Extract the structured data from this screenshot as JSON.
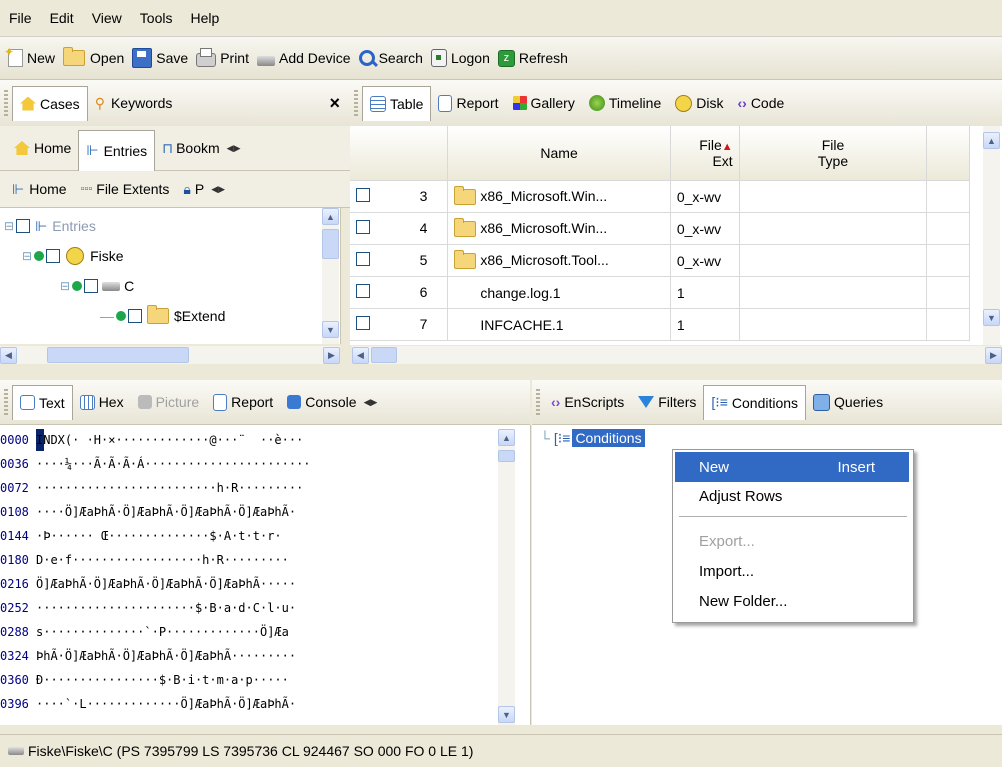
{
  "menu": [
    "File",
    "Edit",
    "View",
    "Tools",
    "Help"
  ],
  "toolbar": [
    {
      "label": "New",
      "icon": "new-icon"
    },
    {
      "label": "Open",
      "icon": "open-folder-icon"
    },
    {
      "label": "Save",
      "icon": "save-icon"
    },
    {
      "label": "Print",
      "icon": "print-icon"
    },
    {
      "label": "Add Device",
      "icon": "add-device-icon"
    },
    {
      "label": "Search",
      "icon": "search-icon"
    },
    {
      "label": "Logon",
      "icon": "logon-icon"
    },
    {
      "label": "Refresh",
      "icon": "refresh-icon"
    }
  ],
  "left_tabs": {
    "cases": "Cases",
    "keywords": "Keywords",
    "close": "×"
  },
  "left_subtabs": {
    "home": "Home",
    "entries": "Entries",
    "bookmarks": "Bookm"
  },
  "left_subtabs2": {
    "home": "Home",
    "file_extents": "File Extents",
    "p": "P"
  },
  "tree": {
    "entries": "Entries",
    "fiske": "Fiske",
    "c": "C",
    "extend": "$Extend"
  },
  "view_tabs": [
    "Table",
    "Report",
    "Gallery",
    "Timeline",
    "Disk",
    "Code"
  ],
  "table": {
    "columns": {
      "name": "Name",
      "ext_line1": "File",
      "ext_line2": "Ext",
      "type_line1": "File",
      "type_line2": "Type"
    },
    "rows": [
      {
        "num": "3",
        "name": "x86_Microsoft.Win...",
        "ext": "0_x-wv",
        "folder": true
      },
      {
        "num": "4",
        "name": "x86_Microsoft.Win...",
        "ext": "0_x-wv",
        "folder": true
      },
      {
        "num": "5",
        "name": "x86_Microsoft.Tool...",
        "ext": "0_x-wv",
        "folder": true
      },
      {
        "num": "6",
        "name": "change.log.1",
        "ext": "1",
        "folder": false
      },
      {
        "num": "7",
        "name": "INFCACHE.1",
        "ext": "1",
        "folder": false
      }
    ]
  },
  "bottom_left_tabs": [
    "Text",
    "Hex",
    "Picture",
    "Report",
    "Console"
  ],
  "bottom_right_tabs": [
    "EnScripts",
    "Filters",
    "Conditions",
    "Queries"
  ],
  "hex": {
    "rows": [
      {
        "off": "0000",
        "text": "INDX(· ·H·×·············@···¨  ··è···"
      },
      {
        "off": "0036",
        "text": "····¼···Ã·Ã·Ã·Á·······················"
      },
      {
        "off": "0072",
        "text": "·························h·R·········"
      },
      {
        "off": "0108",
        "text": "····Ö]ÆaÞhÃ·Ö]ÆaÞhÃ·Ö]ÆaÞhÃ·Ö]ÆaÞhÃ·"
      },
      {
        "off": "0144",
        "text": "·Þ······ Œ··············$·A·t·t·r·"
      },
      {
        "off": "0180",
        "text": "D·e·f··················h·R·········"
      },
      {
        "off": "0216",
        "text": "Ö]ÆaÞhÃ·Ö]ÆaÞhÃ·Ö]ÆaÞhÃ·Ö]ÆaÞhÃ·····"
      },
      {
        "off": "0252",
        "text": "······················$·B·a·d·C·l·u·"
      },
      {
        "off": "0288",
        "text": "s··············`·P·············Ö]Æa"
      },
      {
        "off": "0324",
        "text": "ÞhÃ·Ö]ÆaÞhÃ·Ö]ÆaÞhÃ·Ö]ÆaÞhÃ·········"
      },
      {
        "off": "0360",
        "text": "Ð················$·B·i·t·m·a·p·····"
      },
      {
        "off": "0396",
        "text": "····`·L·············Ö]ÆaÞhÃ·Ö]ÆaÞhÃ·"
      }
    ]
  },
  "conditions": {
    "root": "Conditions"
  },
  "context_menu": {
    "new": "New",
    "new_shortcut": "Insert",
    "adjust_rows": "Adjust Rows",
    "export": "Export...",
    "import": "Import...",
    "new_folder": "New Folder..."
  },
  "status": "Fiske\\Fiske\\C (PS 7395799 LS 7395736 CL 924467 SO 000 FO 0 LE 1)",
  "colors": {
    "selection": "#316ac5",
    "menu_highlight": "#316ac5",
    "xp_face": "#ece9d8"
  }
}
